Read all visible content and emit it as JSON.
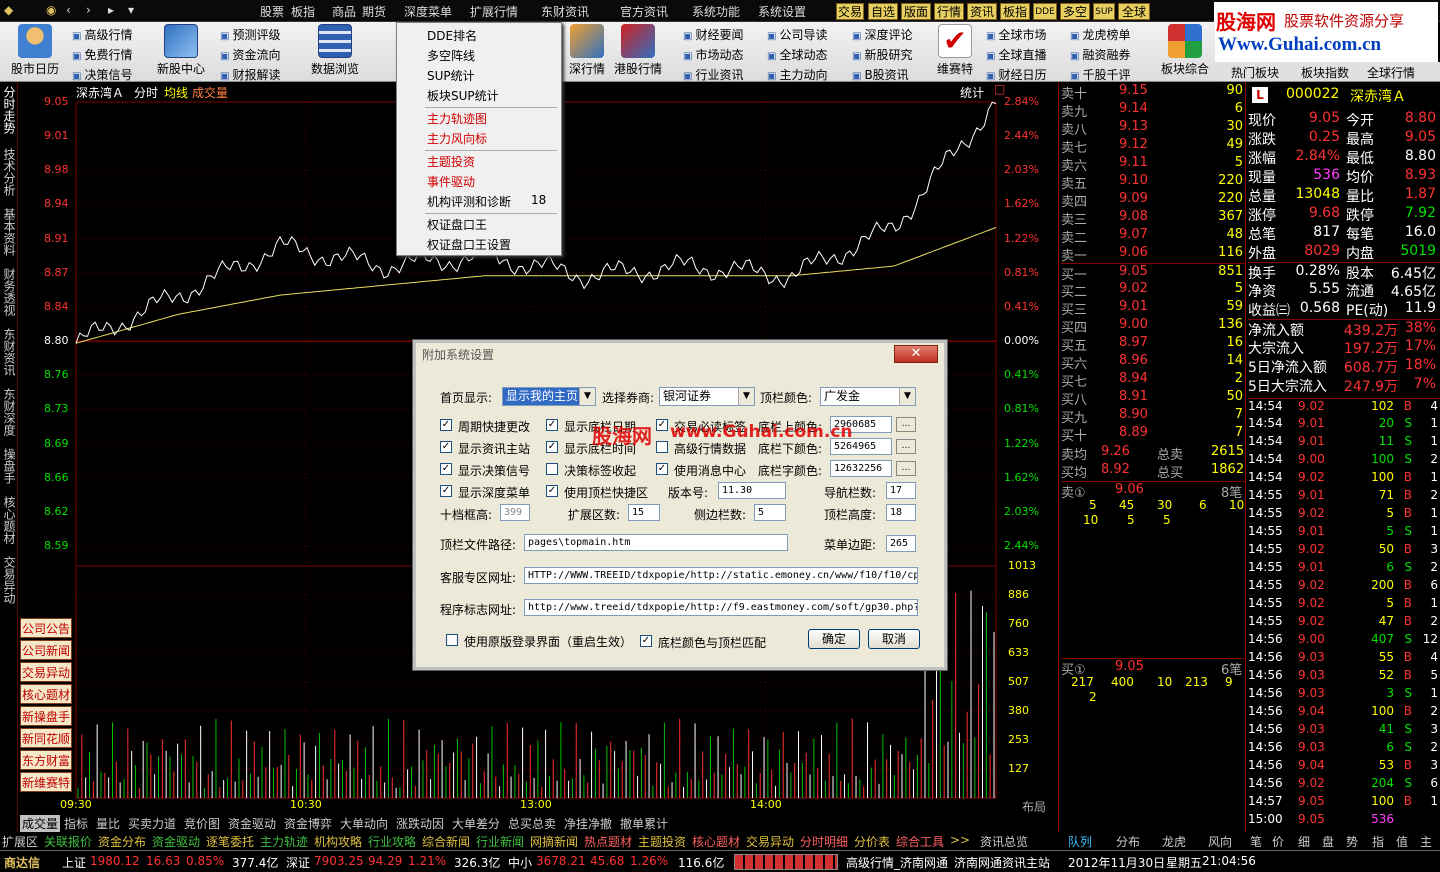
{
  "menubar": {
    "items": [
      "股票",
      "板指",
      "商品",
      "期货",
      "深度菜单",
      "扩展行情",
      "东财资讯",
      "官方资讯",
      "系统功能",
      "系统设置"
    ],
    "buttons": [
      "交易",
      "自选",
      "版面",
      "行情",
      "资讯",
      "板指",
      "DDE",
      "多空",
      "SUP",
      "全球"
    ]
  },
  "logo": {
    "line1": "股海网",
    "line2": "股票软件资源分享",
    "line3": "Www.Guhai.com.cn"
  },
  "toolbar": {
    "big": [
      "股市日历",
      "新股中心",
      "数据浏览",
      "深行情",
      "港股行情",
      "维赛特",
      "板块综合",
      "热门板块",
      "板块指数",
      "全球行情"
    ],
    "col1": [
      "高级行情",
      "免费行情",
      "决策信号"
    ],
    "col2": [
      "预测评级",
      "资金流向",
      "财报解读"
    ],
    "col3": [
      "财经要闻",
      "市场动态",
      "行业资讯"
    ],
    "col4": [
      "公司导读",
      "全球动态",
      "主力动向"
    ],
    "col5": [
      "深度评论",
      "新股研究",
      "B股资讯"
    ],
    "col6": [
      "全球市场",
      "全球直播",
      "财经日历"
    ],
    "col7": [
      "龙虎榜单",
      "融资融券",
      "千股千评"
    ]
  },
  "vtabs": [
    "分时走势",
    "技术分析",
    "基本资料",
    "财务透视",
    "东财资讯",
    "东财深度",
    "操盘手",
    "核心题材",
    "交易异动"
  ],
  "chart": {
    "stock_name": "深赤湾Ａ",
    "label_fs": "分时",
    "label_avg": "均线",
    "label_vol": "成交量",
    "stat": "统计",
    "price_left": [
      "9.05",
      "9.01",
      "8.98",
      "8.94",
      "8.91",
      "8.87",
      "8.84",
      "8.80",
      "8.76",
      "8.73",
      "8.69",
      "8.66",
      "8.62",
      "8.59"
    ],
    "pct_right": [
      "2.84%",
      "2.44%",
      "2.03%",
      "1.62%",
      "1.22%",
      "0.81%",
      "0.41%",
      "0.00%",
      "0.41%",
      "0.81%",
      "1.22%",
      "1.62%",
      "2.03%",
      "2.44%"
    ],
    "vol_right": [
      "1013",
      "886",
      "760",
      "633",
      "507",
      "380",
      "253",
      "127"
    ],
    "time_labels": [
      "09:30",
      "10:30",
      "13:00",
      "14:00"
    ],
    "layout": "布局"
  },
  "chart_data": {
    "type": "line",
    "title": "深赤湾Ａ 分时",
    "x": [
      "09:30",
      "10:00",
      "10:30",
      "11:00",
      "11:30",
      "13:00",
      "13:30",
      "14:00",
      "14:30",
      "15:00"
    ],
    "series": [
      {
        "name": "分时",
        "values": [
          8.8,
          8.85,
          8.9,
          8.88,
          8.89,
          8.87,
          8.88,
          8.87,
          8.92,
          9.05
        ]
      },
      {
        "name": "均线",
        "values": [
          8.8,
          8.83,
          8.85,
          8.86,
          8.87,
          8.87,
          8.87,
          8.87,
          8.88,
          8.92
        ]
      }
    ],
    "ylim": [
      8.59,
      9.05
    ]
  },
  "side_buttons": [
    "公司公告",
    "公司新闻",
    "交易异动",
    "核心题材",
    "新操盘手",
    "新同花顺",
    "东方财富",
    "新维赛特"
  ],
  "orderbook": {
    "sell": [
      [
        "卖十",
        "9.15",
        "90"
      ],
      [
        "卖九",
        "9.14",
        "6"
      ],
      [
        "卖八",
        "9.13",
        "30"
      ],
      [
        "卖七",
        "9.12",
        "49"
      ],
      [
        "卖六",
        "9.11",
        "5"
      ],
      [
        "卖五",
        "9.10",
        "220"
      ],
      [
        "卖四",
        "9.09",
        "220"
      ],
      [
        "卖三",
        "9.08",
        "367"
      ],
      [
        "卖二",
        "9.07",
        "48"
      ],
      [
        "卖一",
        "9.06",
        "116"
      ]
    ],
    "buy": [
      [
        "买一",
        "9.05",
        "851"
      ],
      [
        "买二",
        "9.02",
        "5"
      ],
      [
        "买三",
        "9.01",
        "59"
      ],
      [
        "买四",
        "9.00",
        "136"
      ],
      [
        "买五",
        "8.97",
        "16"
      ],
      [
        "买六",
        "8.96",
        "14"
      ],
      [
        "买七",
        "8.94",
        "2"
      ],
      [
        "买八",
        "8.91",
        "50"
      ],
      [
        "买九",
        "8.90",
        "7"
      ],
      [
        "买十",
        "8.89",
        "7"
      ]
    ],
    "avg_sell": [
      "卖均",
      "9.26",
      "总卖",
      "2615"
    ],
    "avg_buy": [
      "买均",
      "8.92",
      "总买",
      "1862"
    ],
    "sell1_queue": [
      "卖①",
      "9.06",
      "8笔"
    ],
    "sell1_nums": [
      "5",
      "45",
      "30",
      "6",
      "10",
      "10",
      "5",
      "5"
    ],
    "buy1_queue": [
      "买①",
      "9.05",
      "6笔"
    ],
    "buy1_nums": [
      "217",
      "400",
      "10",
      "213",
      "9",
      "2"
    ]
  },
  "quote": {
    "code": "000022",
    "name": "深赤湾Ａ",
    "mark": "L",
    "rows": [
      [
        "现价",
        "9.05",
        "今开",
        "8.80"
      ],
      [
        "涨跌",
        "0.25",
        "最高",
        "9.05"
      ],
      [
        "涨幅",
        "2.84%",
        "最低",
        "8.80"
      ],
      [
        "现量",
        "536",
        "均价",
        "8.93"
      ],
      [
        "总量",
        "13048",
        "量比",
        "1.87"
      ],
      [
        "涨停",
        "9.68",
        "跌停",
        "7.92"
      ],
      [
        "总笔",
        "817",
        "每笔",
        "16.0"
      ],
      [
        "外盘",
        "8029",
        "内盘",
        "5019"
      ],
      [
        "换手",
        "0.28%",
        "股本",
        "6.45亿"
      ],
      [
        "净资",
        "5.55",
        "流通",
        "4.65亿"
      ],
      [
        "收益㈢",
        "0.568",
        "PE(动)",
        "11.9"
      ],
      [
        "净流入额",
        "439.2万",
        "38%",
        ""
      ],
      [
        "大宗流入",
        "197.2万",
        "17%",
        ""
      ],
      [
        "5日净流入额",
        "608.7万",
        "18%",
        ""
      ],
      [
        "5日大宗流入",
        "247.9万",
        "7%",
        ""
      ]
    ],
    "trades": [
      [
        "14:54",
        "9.02",
        "102",
        "B",
        "4"
      ],
      [
        "14:54",
        "9.01",
        "20",
        "S",
        "1"
      ],
      [
        "14:54",
        "9.01",
        "11",
        "S",
        "1"
      ],
      [
        "14:54",
        "9.00",
        "100",
        "S",
        "2"
      ],
      [
        "14:54",
        "9.02",
        "100",
        "B",
        "1"
      ],
      [
        "14:55",
        "9.01",
        "71",
        "B",
        "2"
      ],
      [
        "14:55",
        "9.02",
        "5",
        "B",
        "1"
      ],
      [
        "14:55",
        "9.01",
        "5",
        "S",
        "1"
      ],
      [
        "14:55",
        "9.02",
        "50",
        "B",
        "3"
      ],
      [
        "14:55",
        "9.01",
        "6",
        "S",
        "2"
      ],
      [
        "14:55",
        "9.02",
        "200",
        "B",
        "6"
      ],
      [
        "14:55",
        "9.02",
        "5",
        "B",
        "1"
      ],
      [
        "14:55",
        "9.02",
        "47",
        "B",
        "2"
      ],
      [
        "14:56",
        "9.00",
        "407",
        "S",
        "12"
      ],
      [
        "14:56",
        "9.03",
        "55",
        "B",
        "4"
      ],
      [
        "14:56",
        "9.03",
        "52",
        "B",
        "5"
      ],
      [
        "14:56",
        "9.03",
        "3",
        "S",
        "1"
      ],
      [
        "14:56",
        "9.04",
        "100",
        "B",
        "2"
      ],
      [
        "14:56",
        "9.03",
        "41",
        "S",
        "3"
      ],
      [
        "14:56",
        "9.03",
        "6",
        "S",
        "2"
      ],
      [
        "14:56",
        "9.04",
        "53",
        "B",
        "3"
      ],
      [
        "14:56",
        "9.02",
        "204",
        "S",
        "6"
      ],
      [
        "14:57",
        "9.05",
        "100",
        "B",
        "1"
      ],
      [
        "15:00",
        "9.05",
        "536",
        "",
        ""
      ]
    ]
  },
  "bottom_tabs1": [
    "成交量",
    "指标",
    "量比",
    "买卖力道",
    "竞价图",
    "资金驱动",
    "资金博弈",
    "大单动向",
    "涨跌动因",
    "大单差分",
    "总买总卖",
    "净挂净撤",
    "撤单累计"
  ],
  "bottom_tabs2": [
    "扩展区",
    "关联报价",
    "资金分布",
    "资金驱动",
    "逐笔委托",
    "主力轨迹",
    "机构攻略",
    "行业攻略",
    "综合新闻",
    "行业新闻",
    "网摘新闻",
    "热点题材",
    "主题投资",
    "核心题材",
    "交易异动",
    "分时明细",
    "分价表",
    "综合工具",
    ">>",
    "资讯总览"
  ],
  "right_tabs": [
    "队列",
    "分布",
    "龙虎",
    "风向",
    "笔",
    "价",
    "细",
    "盘",
    "势",
    "指",
    "值",
    "主"
  ],
  "status": {
    "app": "商达信",
    "sh": "上证",
    "sh_val": "1980.12",
    "sh_chg": "16.63",
    "sh_pct": "0.85%",
    "sh_amt": "377.4亿",
    "sz": "深证",
    "sz_val": "7903.25",
    "sz_chg": "94.29",
    "sz_pct": "1.21%",
    "sz_amt": "326.3亿",
    "zx": "中小",
    "zx_val": "3678.21",
    "zx_chg": "45.68",
    "zx_pct": "1.26%",
    "zx_amt": "116.6亿",
    "feed": "高级行情_济南网通",
    "info": "济南网通资讯主站",
    "date": "2012年11月30日",
    "weekday": "星期五",
    "time": "21:04:56"
  },
  "dropdown": {
    "items": [
      "DDE排名",
      "多空阵线",
      "SUP统计",
      "板块SUP统计",
      "主力轨迹图",
      "主力风向标",
      "主题投资",
      "事件驱动",
      "机构评测和诊断",
      "权证盘口王",
      "权证盘口王设置"
    ],
    "badge": "18"
  },
  "dialog": {
    "title": "附加系统设置",
    "home_label": "首页显示:",
    "home_value": "显示我的主页",
    "broker_label": "选择券商:",
    "broker_value": "银河证券",
    "topcolor_label": "顶栏颜色:",
    "topcolor_value": "广发金",
    "checks": [
      "周期快捷更改",
      "显示资讯主站",
      "显示决策信号",
      "显示深度菜单",
      "显示底栏日期",
      "显示底栏时间",
      "决策标签收起",
      "使用顶栏快捷区",
      "交易必读标签",
      "高级行情数据",
      "使用消息中心"
    ],
    "botcolor_up_label": "底栏上颜色:",
    "botcolor_up": "2960685",
    "botcolor_dn_label": "底栏下颜色:",
    "botcolor_dn": "5264965",
    "botcolor_font_label": "底栏字颜色:",
    "botcolor_font": "12632256",
    "version_label": "版本号:",
    "version": "11.30",
    "nav_label": "导航栏数:",
    "nav": "17",
    "ten_label": "十档框高:",
    "ten": "399",
    "ext_label": "扩展区数:",
    "ext": "15",
    "side_label": "侧边栏数:",
    "side": "5",
    "top_label": "顶栏高度:",
    "top": "18",
    "toppath_label": "顶栏文件路径:",
    "toppath": "pages\\topmain.htm",
    "menumargin_label": "菜单边距:",
    "menumargin": "265",
    "svc_label": "客服专区网址:",
    "svc": "HTTP://WWW.TREEID/tdxpopie/http://static.emoney.cn/www/f10/f10/cp",
    "flag_label": "程序标志网址:",
    "flag": "http://www.treeid/tdxpopie/http://f9.eastmoney.com/soft/gp30.php?",
    "orig_login": "使用原版登录界面（重启生效）",
    "match_color": "底栏颜色与顶栏匹配",
    "ok": "确定",
    "cancel": "取消"
  },
  "watermark": {
    "a": "股海网",
    "b": "www.Guhai.com.cn"
  }
}
